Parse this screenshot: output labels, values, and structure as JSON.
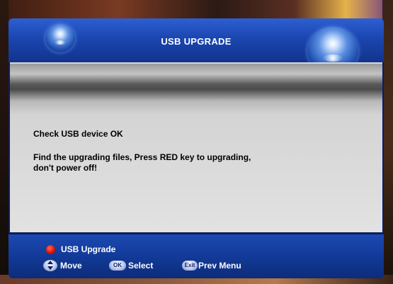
{
  "header": {
    "title": "USB UPGRADE"
  },
  "messages": {
    "line1": "Check USB device OK",
    "line2": "Find the upgrading files, Press RED key to upgrading,",
    "line3": "don't power off!"
  },
  "footer": {
    "red_action": "USB Upgrade",
    "move_label": "Move",
    "ok_badge": "OK",
    "select_label": "Select",
    "exit_badge": "Exit",
    "prev_label": "Prev Menu"
  },
  "colors": {
    "header_blue": "#1b46b0",
    "panel_navy": "#0b1c66",
    "content_gray": "#d4d4d4",
    "red_key": "#e0140a"
  },
  "icons": [
    "orb-icon",
    "red-key-icon",
    "up-down-arrow-icon",
    "ok-key-icon",
    "exit-key-icon"
  ]
}
